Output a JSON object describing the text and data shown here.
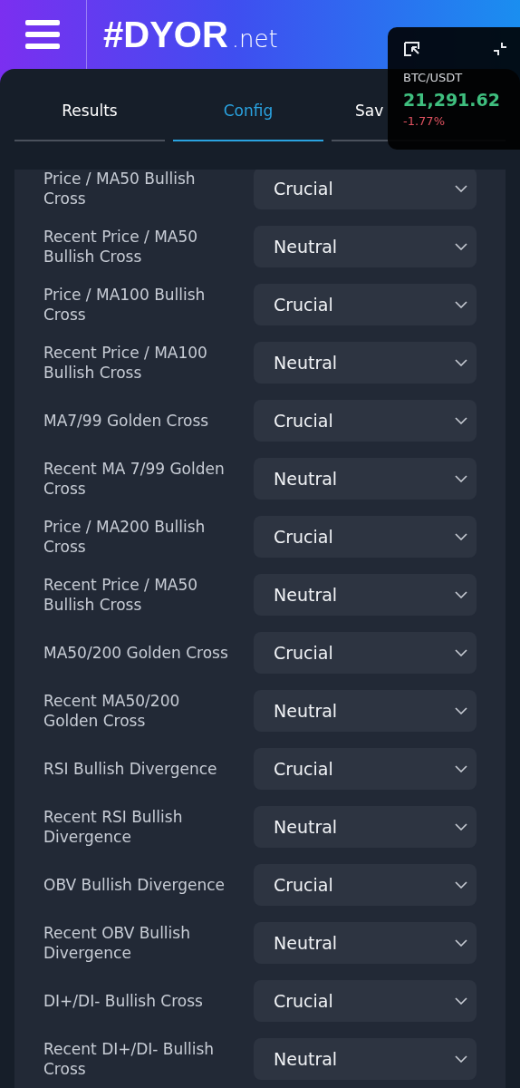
{
  "header": {
    "logo_main": "#DYOR",
    "logo_suffix": ".net"
  },
  "tabs": [
    {
      "label": "Results",
      "selected": false
    },
    {
      "label": "Config",
      "selected": true
    },
    {
      "label": "Sav",
      "selected": false
    }
  ],
  "ticker": {
    "pair": "BTC/USDT",
    "price": "21,291.62",
    "change": "-1.77%"
  },
  "settings": [
    {
      "label": "Price / MA50 Bullish Cross",
      "value": "Crucial"
    },
    {
      "label": "Recent Price / MA50 Bullish Cross",
      "value": "Neutral"
    },
    {
      "label": "Price / MA100 Bullish Cross",
      "value": "Crucial"
    },
    {
      "label": "Recent Price / MA100 Bullish Cross",
      "value": "Neutral"
    },
    {
      "label": "MA7/99 Golden Cross",
      "value": "Crucial"
    },
    {
      "label": "Recent MA 7/99 Golden Cross",
      "value": "Neutral"
    },
    {
      "label": "Price / MA200 Bullish Cross",
      "value": "Crucial"
    },
    {
      "label": "Recent Price / MA50 Bullish Cross",
      "value": "Neutral"
    },
    {
      "label": "MA50/200 Golden Cross",
      "value": "Crucial"
    },
    {
      "label": "Recent MA50/200 Golden Cross",
      "value": "Neutral"
    },
    {
      "label": "RSI Bullish Divergence",
      "value": "Crucial"
    },
    {
      "label": "Recent RSI Bullish Divergence",
      "value": "Neutral"
    },
    {
      "label": "OBV Bullish Divergence",
      "value": "Crucial"
    },
    {
      "label": "Recent OBV Bullish Divergence",
      "value": "Neutral"
    },
    {
      "label": "DI+/DI- Bullish Cross",
      "value": "Crucial"
    },
    {
      "label": "Recent DI+/DI- Bullish Cross",
      "value": "Neutral"
    }
  ]
}
